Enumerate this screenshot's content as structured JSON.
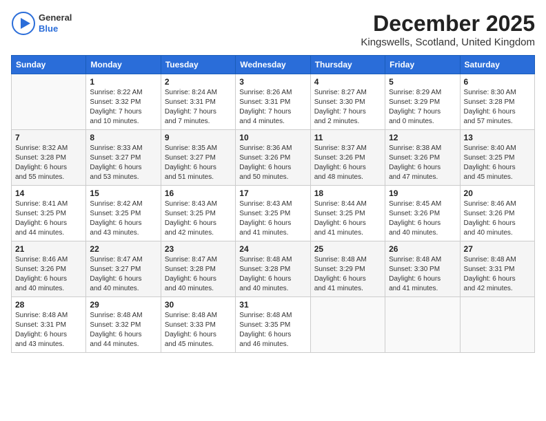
{
  "logo": {
    "line1": "General",
    "line2": "Blue"
  },
  "header": {
    "month": "December 2025",
    "location": "Kingswells, Scotland, United Kingdom"
  },
  "weekdays": [
    "Sunday",
    "Monday",
    "Tuesday",
    "Wednesday",
    "Thursday",
    "Friday",
    "Saturday"
  ],
  "weeks": [
    [
      {
        "day": "",
        "info": ""
      },
      {
        "day": "1",
        "info": "Sunrise: 8:22 AM\nSunset: 3:32 PM\nDaylight: 7 hours\nand 10 minutes."
      },
      {
        "day": "2",
        "info": "Sunrise: 8:24 AM\nSunset: 3:31 PM\nDaylight: 7 hours\nand 7 minutes."
      },
      {
        "day": "3",
        "info": "Sunrise: 8:26 AM\nSunset: 3:31 PM\nDaylight: 7 hours\nand 4 minutes."
      },
      {
        "day": "4",
        "info": "Sunrise: 8:27 AM\nSunset: 3:30 PM\nDaylight: 7 hours\nand 2 minutes."
      },
      {
        "day": "5",
        "info": "Sunrise: 8:29 AM\nSunset: 3:29 PM\nDaylight: 7 hours\nand 0 minutes."
      },
      {
        "day": "6",
        "info": "Sunrise: 8:30 AM\nSunset: 3:28 PM\nDaylight: 6 hours\nand 57 minutes."
      }
    ],
    [
      {
        "day": "7",
        "info": "Sunrise: 8:32 AM\nSunset: 3:28 PM\nDaylight: 6 hours\nand 55 minutes."
      },
      {
        "day": "8",
        "info": "Sunrise: 8:33 AM\nSunset: 3:27 PM\nDaylight: 6 hours\nand 53 minutes."
      },
      {
        "day": "9",
        "info": "Sunrise: 8:35 AM\nSunset: 3:27 PM\nDaylight: 6 hours\nand 51 minutes."
      },
      {
        "day": "10",
        "info": "Sunrise: 8:36 AM\nSunset: 3:26 PM\nDaylight: 6 hours\nand 50 minutes."
      },
      {
        "day": "11",
        "info": "Sunrise: 8:37 AM\nSunset: 3:26 PM\nDaylight: 6 hours\nand 48 minutes."
      },
      {
        "day": "12",
        "info": "Sunrise: 8:38 AM\nSunset: 3:26 PM\nDaylight: 6 hours\nand 47 minutes."
      },
      {
        "day": "13",
        "info": "Sunrise: 8:40 AM\nSunset: 3:25 PM\nDaylight: 6 hours\nand 45 minutes."
      }
    ],
    [
      {
        "day": "14",
        "info": "Sunrise: 8:41 AM\nSunset: 3:25 PM\nDaylight: 6 hours\nand 44 minutes."
      },
      {
        "day": "15",
        "info": "Sunrise: 8:42 AM\nSunset: 3:25 PM\nDaylight: 6 hours\nand 43 minutes."
      },
      {
        "day": "16",
        "info": "Sunrise: 8:43 AM\nSunset: 3:25 PM\nDaylight: 6 hours\nand 42 minutes."
      },
      {
        "day": "17",
        "info": "Sunrise: 8:43 AM\nSunset: 3:25 PM\nDaylight: 6 hours\nand 41 minutes."
      },
      {
        "day": "18",
        "info": "Sunrise: 8:44 AM\nSunset: 3:25 PM\nDaylight: 6 hours\nand 41 minutes."
      },
      {
        "day": "19",
        "info": "Sunrise: 8:45 AM\nSunset: 3:26 PM\nDaylight: 6 hours\nand 40 minutes."
      },
      {
        "day": "20",
        "info": "Sunrise: 8:46 AM\nSunset: 3:26 PM\nDaylight: 6 hours\nand 40 minutes."
      }
    ],
    [
      {
        "day": "21",
        "info": "Sunrise: 8:46 AM\nSunset: 3:26 PM\nDaylight: 6 hours\nand 40 minutes."
      },
      {
        "day": "22",
        "info": "Sunrise: 8:47 AM\nSunset: 3:27 PM\nDaylight: 6 hours\nand 40 minutes."
      },
      {
        "day": "23",
        "info": "Sunrise: 8:47 AM\nSunset: 3:28 PM\nDaylight: 6 hours\nand 40 minutes."
      },
      {
        "day": "24",
        "info": "Sunrise: 8:48 AM\nSunset: 3:28 PM\nDaylight: 6 hours\nand 40 minutes."
      },
      {
        "day": "25",
        "info": "Sunrise: 8:48 AM\nSunset: 3:29 PM\nDaylight: 6 hours\nand 41 minutes."
      },
      {
        "day": "26",
        "info": "Sunrise: 8:48 AM\nSunset: 3:30 PM\nDaylight: 6 hours\nand 41 minutes."
      },
      {
        "day": "27",
        "info": "Sunrise: 8:48 AM\nSunset: 3:31 PM\nDaylight: 6 hours\nand 42 minutes."
      }
    ],
    [
      {
        "day": "28",
        "info": "Sunrise: 8:48 AM\nSunset: 3:31 PM\nDaylight: 6 hours\nand 43 minutes."
      },
      {
        "day": "29",
        "info": "Sunrise: 8:48 AM\nSunset: 3:32 PM\nDaylight: 6 hours\nand 44 minutes."
      },
      {
        "day": "30",
        "info": "Sunrise: 8:48 AM\nSunset: 3:33 PM\nDaylight: 6 hours\nand 45 minutes."
      },
      {
        "day": "31",
        "info": "Sunrise: 8:48 AM\nSunset: 3:35 PM\nDaylight: 6 hours\nand 46 minutes."
      },
      {
        "day": "",
        "info": ""
      },
      {
        "day": "",
        "info": ""
      },
      {
        "day": "",
        "info": ""
      }
    ]
  ]
}
